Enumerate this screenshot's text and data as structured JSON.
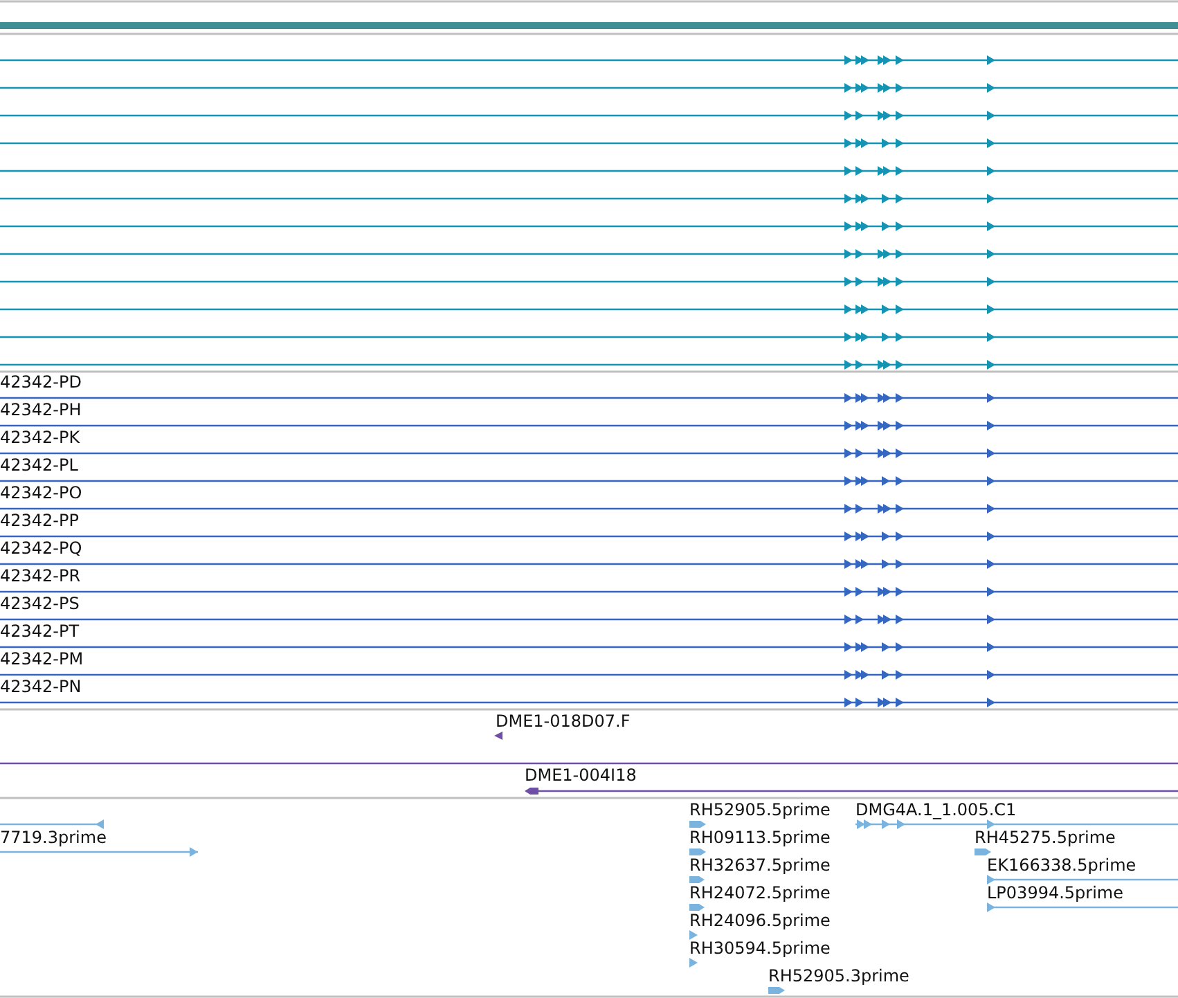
{
  "tracks": [
    {
      "kind": "gene",
      "color": "#1593b3",
      "features": [
        {
          "reverse": false
        },
        {
          "reverse": false
        },
        {
          "reverse": false
        },
        {
          "reverse": false
        },
        {
          "reverse": false
        },
        {
          "reverse": false
        },
        {
          "reverse": false
        },
        {
          "reverse": false
        },
        {
          "reverse": false
        },
        {
          "reverse": false
        },
        {
          "reverse": false
        },
        {
          "reverse": false
        }
      ]
    },
    {
      "kind": "gene",
      "color": "#3566c0",
      "features": [
        {
          "label": "42342-PD",
          "reverse": false
        },
        {
          "label": "42342-PH",
          "reverse": false
        },
        {
          "label": "42342-PK",
          "reverse": false
        },
        {
          "label": "42342-PL",
          "reverse": false
        },
        {
          "label": "42342-PO",
          "reverse": false
        },
        {
          "label": "42342-PP",
          "reverse": false
        },
        {
          "label": "42342-PQ",
          "reverse": false
        },
        {
          "label": "42342-PR",
          "reverse": false
        },
        {
          "label": "42342-PS",
          "reverse": false
        },
        {
          "label": "42342-PT",
          "reverse": false
        },
        {
          "label": "42342-PM",
          "reverse": false
        },
        {
          "label": "42342-PN",
          "reverse": false
        }
      ]
    },
    {
      "kind": "clone",
      "color": "#6f4fa6",
      "features": [
        {
          "label": "DME1-018D07.F",
          "reverse": true
        },
        {
          "kind": "line"
        },
        {
          "label": "DME1-004I18",
          "reverse": true
        }
      ]
    },
    {
      "kind": "est",
      "color": "#7ab4de",
      "features": [
        {
          "reverse": true
        },
        {
          "label": "7719.3prime",
          "reverse": false
        },
        {
          "label": "RH52905.5prime",
          "reverse": false
        },
        {
          "label": "RH09113.5prime",
          "reverse": false
        },
        {
          "label": "RH32637.5prime",
          "reverse": false
        },
        {
          "label": "RH24072.5prime",
          "reverse": false
        },
        {
          "label": "RH24096.5prime",
          "reverse": false
        },
        {
          "label": "RH30594.5prime",
          "reverse": false
        },
        {
          "label": "DMG4A.1_1.005.C1",
          "reverse": false
        },
        {
          "label": "RH45275.5prime",
          "reverse": false
        },
        {
          "label": "EK166338.5prime",
          "reverse": false
        },
        {
          "label": "LP03994.5prime",
          "reverse": false
        },
        {
          "label": "RH52905.3prime",
          "reverse": false
        }
      ]
    }
  ]
}
